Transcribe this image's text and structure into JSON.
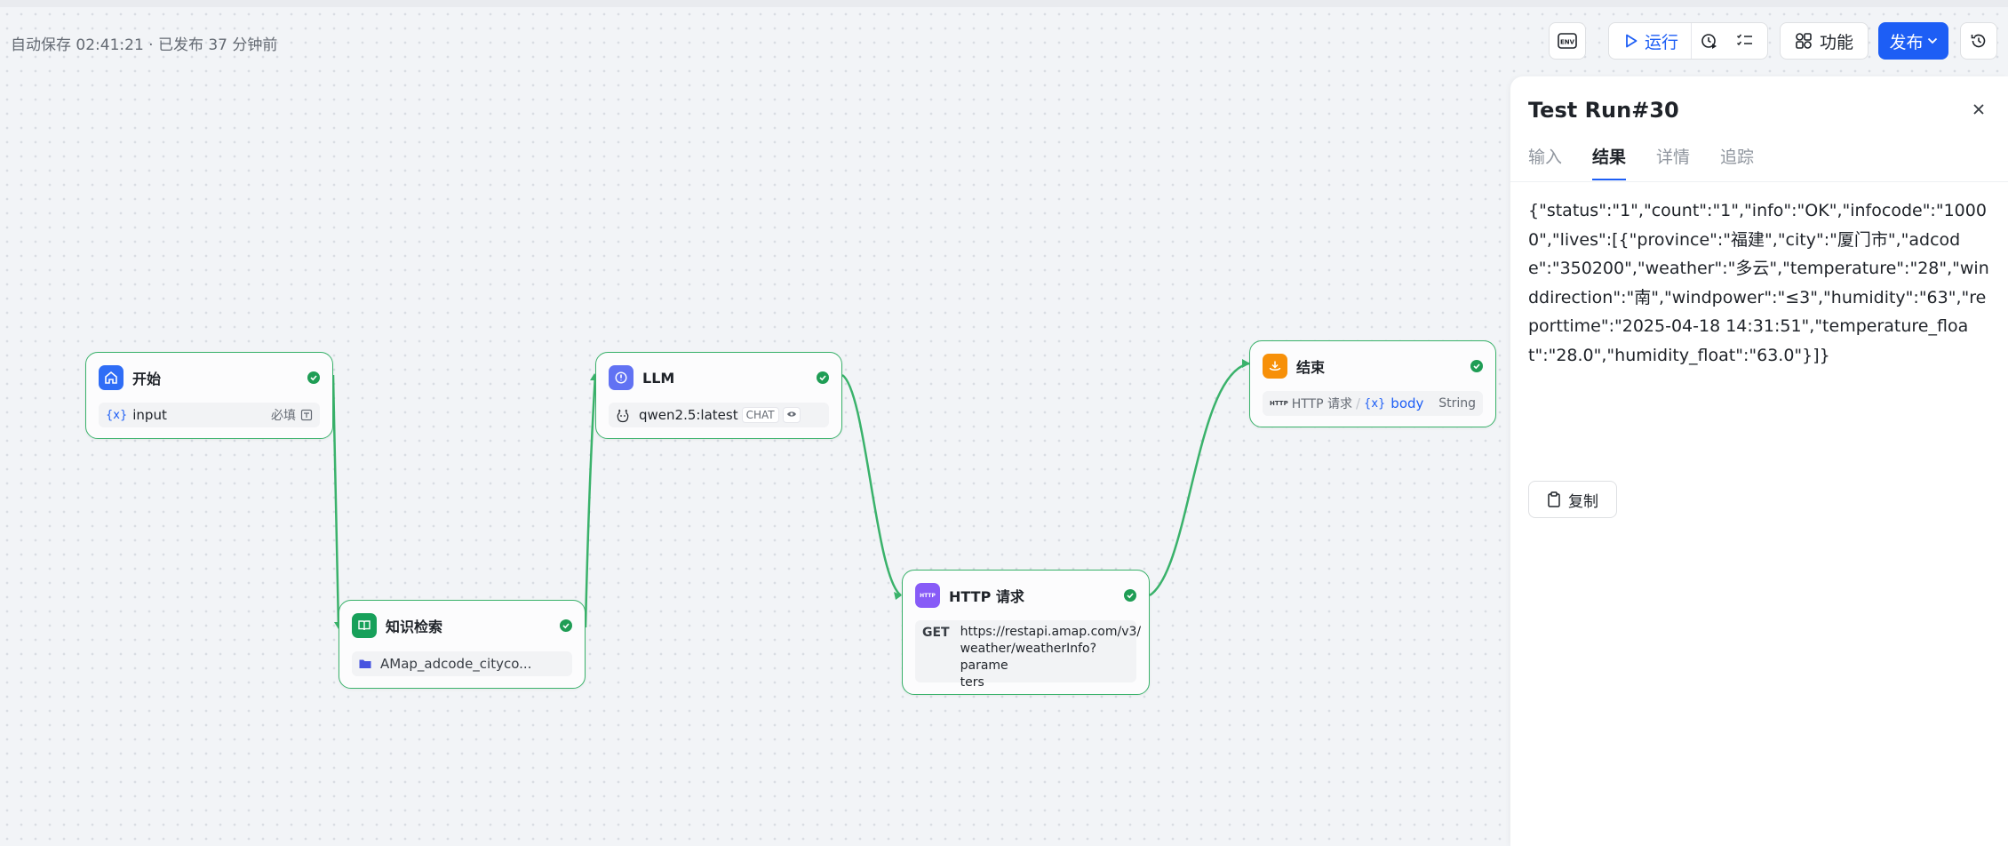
{
  "autosave": "自动保存 02:41:21 · 已发布 37 分钟前",
  "toolbar": {
    "env_icon": "env-icon",
    "run_label": "运行",
    "features_label": "功能",
    "publish_label": "发布"
  },
  "nodes": {
    "start": {
      "title": "开始",
      "var_tag": "{x}",
      "var_name": "input",
      "required": "必填"
    },
    "knowledge": {
      "title": "知识检索",
      "dataset": "AMap_adcode_cityco..."
    },
    "llm": {
      "title": "LLM",
      "model": "qwen2.5:latest",
      "mode": "CHAT"
    },
    "http": {
      "title": "HTTP 请求",
      "method": "GET",
      "url_line1": "https://restapi.amap.com/v3/",
      "url_line2": "weather/weatherInfo?parame",
      "url_line3": "ters",
      "icon_text": "HTTP"
    },
    "end": {
      "title": "结束",
      "http_prefix": "HTTP",
      "source": "HTTP 请求",
      "var_tag": "{x}",
      "var_name": "body",
      "type": "String"
    }
  },
  "panel": {
    "title": "Test Run#30",
    "tabs": [
      "输入",
      "结果",
      "详情",
      "追踪"
    ],
    "active_tab": "结果",
    "result": "{\"status\":\"1\",\"count\":\"1\",\"info\":\"OK\",\"infocode\":\"10000\",\"lives\":[{\"province\":\"福建\",\"city\":\"厦门市\",\"adcode\":\"350200\",\"weather\":\"多云\",\"temperature\":\"28\",\"winddirection\":\"南\",\"windpower\":\"≤3\",\"humidity\":\"63\",\"reporttime\":\"2025-04-18 14:31:51\",\"temperature_float\":\"28.0\",\"humidity_float\":\"63.0\"}]}",
    "copy_label": "复制"
  },
  "colors": {
    "accent": "#1d5ef5",
    "edge": "#3ab26b",
    "start_icon": "#2f6df6",
    "knowledge_icon": "#17a05a",
    "llm_icon": "#6172f3",
    "http_icon": "#875bf7",
    "end_icon": "#f79009"
  }
}
